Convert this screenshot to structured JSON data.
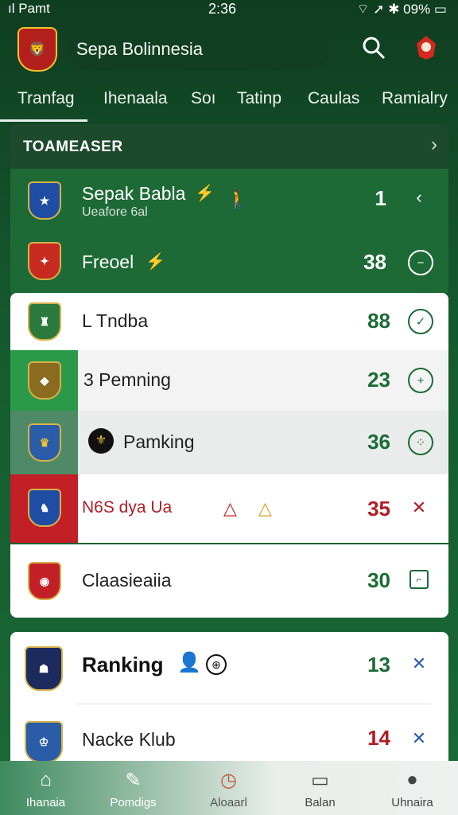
{
  "status_bar": {
    "left": "ıl Pamt",
    "time": "2:36",
    "battery": "09%"
  },
  "header": {
    "title": "Sepa Bolinnesia",
    "logo": "lion-crest-icon",
    "search_icon": "search-icon",
    "profile_icon": "mascot-icon"
  },
  "tabs": [
    {
      "label": "Tranfag"
    },
    {
      "label": "Ihenaala"
    },
    {
      "label": "Soı"
    },
    {
      "label": "Tatinp"
    },
    {
      "label": "Caulas"
    },
    {
      "label": "Ramialry"
    }
  ],
  "section": {
    "title": "TOAMEASER"
  },
  "rows": [
    {
      "name": "Sepak Babla",
      "sub": "Ueafore 6al",
      "value": "1",
      "icon": "back-arrow-icon",
      "value_color": "#ffffff"
    },
    {
      "name": "Freoel",
      "value": "38",
      "icon": "minus-circle-icon",
      "value_color": "#ffffff"
    },
    {
      "name": "L Tndba",
      "value": "88",
      "icon": "check-circle-icon",
      "value_color": "#1c6b37"
    },
    {
      "name": "3 Pemning",
      "value": "23",
      "icon": "plus-circle-icon",
      "value_color": "#1c6b37"
    },
    {
      "name": "Pamking",
      "value": "36",
      "icon": "dots-circle-icon",
      "value_color": "#1c6b37"
    },
    {
      "name": "N6S dya Ua",
      "value": "35",
      "icon": "cross-icon",
      "value_color": "#b11d25"
    },
    {
      "name": "Claasieaiia",
      "value": "30",
      "icon": "square-icon",
      "value_color": "#1c6b37"
    },
    {
      "name": "Ranking",
      "value": "13",
      "icon": "cross-icon",
      "value_color": "#1c6b37"
    },
    {
      "name": "Nacke Klub",
      "value": "14",
      "icon": "cross-icon",
      "value_color": "#b11d25"
    }
  ],
  "bottom_nav": [
    {
      "label": "Ihanaia",
      "icon": "home-icon"
    },
    {
      "label": "Pomdigs",
      "icon": "edit-box-icon"
    },
    {
      "label": "Aloaarl",
      "icon": "timer-icon"
    },
    {
      "label": "Balan",
      "icon": "message-icon"
    },
    {
      "label": "Uhnaira",
      "icon": "profile-icon"
    }
  ]
}
